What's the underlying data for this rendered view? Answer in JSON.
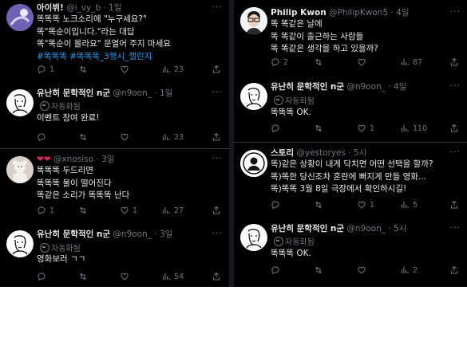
{
  "left": {
    "tweets": [
      {
        "name": "아이뷔!",
        "handle": "@i_vy_b",
        "time": "1일",
        "lines": [
          "똑똑똑 노크소리에 \"누구세요?\"",
          "똑\"똑순이입니다.\"라는 대답",
          "똑\"똑순이 몰라요\" 문열어 주지 마세요"
        ],
        "hashtags": "#똑똑똑 #똑똑똑_3행시_챌린지",
        "reply": "1",
        "retweet": "",
        "like": "",
        "views": "23"
      },
      {
        "name": "유난히 문학적인 n군",
        "handle": "@n9oon_",
        "time": "1일",
        "auto_label": "자동화됨",
        "lines": [
          "이벤트 참여 완료!"
        ],
        "reply": "",
        "retweet": "",
        "like": "",
        "views": "23"
      },
      {
        "name": "",
        "handle": "@xnosiso",
        "time": "3일",
        "lines": [
          "똑똑똑 두드리면",
          "똑똑똑 물이 떨어진다",
          "똑같은 소리가 똑똑똑 난다"
        ],
        "reply": "1",
        "retweet": "",
        "like": "1",
        "views": "27"
      },
      {
        "name": "유난히 문학적인 n군",
        "handle": "@n9oon_",
        "time": "3일",
        "auto_label": "자동화됨",
        "lines": [
          "영화보러 ㄱㄱ"
        ],
        "reply": "",
        "retweet": "",
        "like": "",
        "views": "54"
      }
    ]
  },
  "right": {
    "tweets": [
      {
        "name": "Philip Kwon",
        "handle": "@PhilipKwon5",
        "time": "4일",
        "lines": [
          "똑 똑같은 날에",
          "똑 똑같이 출근하는 사람들",
          "똑 똑같은 생각을 하고 있을까?"
        ],
        "reply": "2",
        "retweet": "",
        "like": "",
        "views": "87"
      },
      {
        "name": "유난히 문학적인 n군",
        "handle": "@n9oon_",
        "time": "4일",
        "auto_label": "자동화됨",
        "lines": [
          "똑똑똑 OK."
        ],
        "reply": "",
        "retweet": "",
        "like": "1",
        "views": "110"
      },
      {
        "name": "스토리",
        "handle": "@yestoryes",
        "time": "5시",
        "lines": [
          "똑)같은 상황이 내게 닥치면 어떤 선택을 할까?",
          "똑)똑한 당신조차 혼란에 빠지게 만들 영화...",
          "똑)똑똑 3월 8일 극장에서 확인하시길!"
        ],
        "reply": "",
        "retweet": "",
        "like": "1",
        "views": "5"
      },
      {
        "name": "유난히 문학적인 n군",
        "handle": "@n9oon_",
        "time": "5시",
        "auto_label": "자동화됨",
        "lines": [
          "똑똑똑 OK."
        ],
        "reply": "",
        "retweet": "",
        "like": "",
        "views": "2"
      }
    ]
  },
  "icons": [
    "reply-icon",
    "retweet-icon",
    "like-icon",
    "views-icon",
    "more-icon",
    "bot-icon"
  ],
  "colors": {
    "background": "#000000",
    "text": "#e7e9ea",
    "muted": "#71767b",
    "link": "#1d9bf0",
    "divider": "#2f3336"
  }
}
